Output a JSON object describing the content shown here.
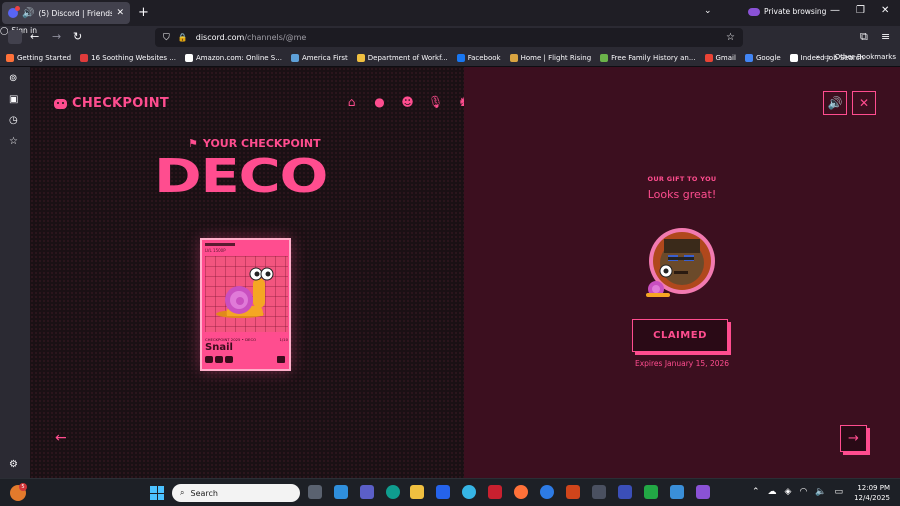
{
  "browser": {
    "tab_title": "(5) Discord | Friends",
    "new_tab_label": "+",
    "private_label": "Private browsing",
    "url_host": "discord.com",
    "url_path": "/channels/@me",
    "signin_label": "Sign in"
  },
  "bookmarks": [
    {
      "label": "Getting Started",
      "color": "#ff7139"
    },
    {
      "label": "16 Soothing Websites ...",
      "color": "#e03b3b"
    },
    {
      "label": "Amazon.com: Online S...",
      "color": "#ffffff"
    },
    {
      "label": "America First",
      "color": "#5ea0d8"
    },
    {
      "label": "Department of Workf...",
      "color": "#f0c040"
    },
    {
      "label": "Facebook",
      "color": "#1877f2"
    },
    {
      "label": "Home | Flight Rising",
      "color": "#d9a441"
    },
    {
      "label": "Free Family History an...",
      "color": "#6bb34a"
    },
    {
      "label": "Gmail",
      "color": "#ea4335"
    },
    {
      "label": "Google",
      "color": "#4285f4"
    },
    {
      "label": "Indeed Job Search",
      "color": "#ffffff"
    }
  ],
  "other_bookmarks": "Other Bookmarks",
  "page": {
    "logo_text": "CHECKPOINT",
    "your_checkpoint": "YOUR CHECKPOINT",
    "title": "DECO",
    "card": {
      "number": "LVL 1500P",
      "caption_left": "CHECKPOINT 2025 • DECO",
      "caption_right": "1/10",
      "name": "Snail"
    },
    "gift_label": "OUR GIFT TO YOU",
    "gift_message": "Looks great!",
    "claimed_label": "CLAIMED",
    "expires": "Expires January 15, 2026",
    "accent_color": "#ff4d8f"
  },
  "taskbar": {
    "weather_badge": "5",
    "search_placeholder": "Search",
    "time": "12:09 PM",
    "date": "12/4/2025"
  }
}
